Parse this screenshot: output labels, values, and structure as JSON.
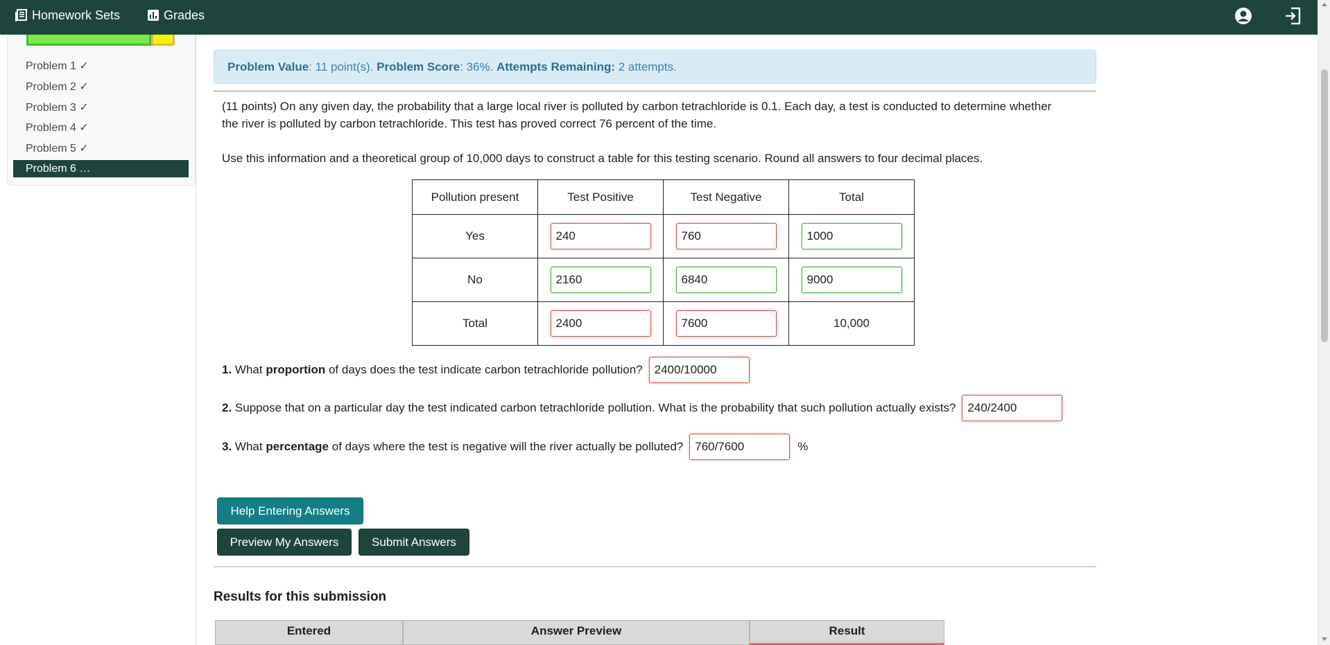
{
  "nav": {
    "homework_label": "Homework Sets",
    "grades_label": "Grades"
  },
  "sidebar": {
    "problems": [
      "Problem 1 ✓",
      "Problem 2 ✓",
      "Problem 3 ✓",
      "Problem 4 ✓",
      "Problem 5 ✓"
    ],
    "active": "Problem 6 …"
  },
  "alert": {
    "value_label": "Problem Value",
    "value_text": ": 11 point(s). ",
    "score_label": "Problem Score",
    "score_text": ": 36%. ",
    "attempts_label": "Attempts Remaining:",
    "attempts_text": " 2 attempts."
  },
  "problem": {
    "intro_line1": "(11 points) On any given day, the probability that a large local river is polluted by carbon tetrachloride is 0.1. Each day, a test is conducted to determine whether",
    "intro_line2": "the river is polluted by carbon tetrachloride. This test has proved correct 76 percent of the time.",
    "instruction": "Use this information and a theoretical group of 10,000 days to construct a table for this testing scenario. Round all answers to four decimal places."
  },
  "table": {
    "headers": [
      "Pollution present",
      "Test Positive",
      "Test Negative",
      "Total"
    ],
    "rows": [
      {
        "label": "Yes",
        "pos": "240",
        "neg": "760",
        "total": "1000"
      },
      {
        "label": "No",
        "pos": "2160",
        "neg": "6840",
        "total": "9000"
      },
      {
        "label": "Total",
        "pos": "2400",
        "neg": "7600",
        "total": "10,000"
      }
    ]
  },
  "questions": [
    {
      "num": "1.",
      "pre": " What ",
      "bold": "proportion",
      "post": " of days does the test indicate carbon tetrachloride pollution?",
      "answer": "2400/10000"
    },
    {
      "num": "2.",
      "text": " Suppose that on a particular day the test indicated carbon tetrachloride pollution. What is the probability that such pollution actually exists?",
      "answer": "240/2400"
    },
    {
      "num": "3.",
      "pre": " What ",
      "bold": "percentage",
      "post": " of days where the test is negative will the river actually be polluted?",
      "answer": "760/7600",
      "suffix": "%"
    }
  ],
  "buttons": {
    "help": "Help Entering Answers",
    "preview": "Preview My Answers",
    "submit": "Submit Answers"
  },
  "results": {
    "title": "Results for this submission",
    "columns": [
      "Entered",
      "Answer Preview",
      "Result"
    ]
  }
}
